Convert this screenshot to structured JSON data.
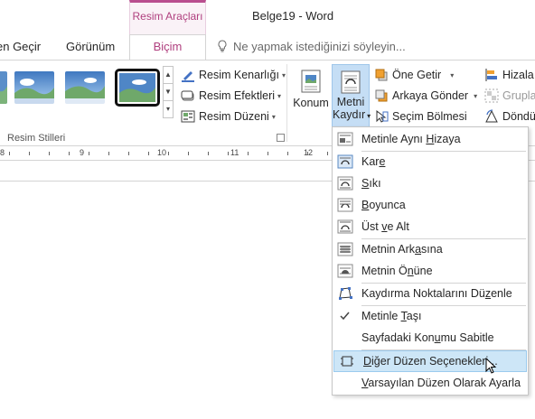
{
  "titlebar": {
    "context_group": "Resim Araçları",
    "doc_title": "Belge19 - Word"
  },
  "tabs": [
    {
      "label": "en Geçir"
    },
    {
      "label": "Görünüm"
    },
    {
      "label": "Biçim",
      "active": true
    }
  ],
  "tellme": {
    "placeholder": "Ne yapmak istediğinizi söyleyin..."
  },
  "ribbon": {
    "picture_styles": {
      "label": "Resim Stilleri"
    },
    "commands": {
      "border": "Resim Kenarlığı",
      "effects": "Resim Efektleri",
      "layout": "Resim Düzeni",
      "position": "Konum",
      "wrap_line1": "Metni",
      "wrap_line2": "Kaydır",
      "bring_forward": "Öne Getir",
      "send_backward": "Arkaya Gönder",
      "selection_pane": "Seçim Bölmesi",
      "align": "Hizala",
      "group": "Gruplar",
      "rotate": "Döndü"
    }
  },
  "ruler": {
    "numbers": [
      "8",
      "9",
      "10",
      "11",
      "12"
    ]
  },
  "menu": {
    "items": [
      {
        "pre": "Metinle Aynı ",
        "ul": "H",
        "post": "izaya",
        "icon": "inline-with-text-icon"
      },
      {
        "pre": "Kar",
        "ul": "e",
        "post": "",
        "icon": "square-wrap-icon"
      },
      {
        "pre": "",
        "ul": "S",
        "post": "ıkı",
        "icon": "tight-wrap-icon"
      },
      {
        "pre": "",
        "ul": "B",
        "post": "oyunca",
        "icon": "through-wrap-icon"
      },
      {
        "pre": "Üst ",
        "ul": "v",
        "post": "e Alt",
        "icon": "top-bottom-wrap-icon"
      },
      {
        "pre": "Metnin Ark",
        "ul": "a",
        "post": "sına",
        "icon": "behind-text-icon"
      },
      {
        "pre": "Metnin Ö",
        "ul": "n",
        "post": "üne",
        "icon": "in-front-text-icon"
      },
      {
        "pre": "Kaydırma Noktalarını Dü",
        "ul": "z",
        "post": "enle",
        "icon": "edit-wrap-points-icon"
      },
      {
        "pre": "Metinle ",
        "ul": "T",
        "post": "aşı",
        "icon": "checkmark-icon"
      },
      {
        "pre": "Sayfadaki Kon",
        "ul": "u",
        "post": "mu Sabitle",
        "icon": ""
      },
      {
        "pre": "",
        "ul": "D",
        "post": "iğer Düzen Seçenekleri...",
        "icon": "layout-options-icon"
      },
      {
        "pre": "",
        "ul": "V",
        "post": "arsayılan Düzen Olarak Ayarla",
        "icon": ""
      }
    ]
  },
  "colors": {
    "accent": "#b0407f",
    "hover_bg": "#cde6f7",
    "pressed_bg": "#c5def5"
  }
}
